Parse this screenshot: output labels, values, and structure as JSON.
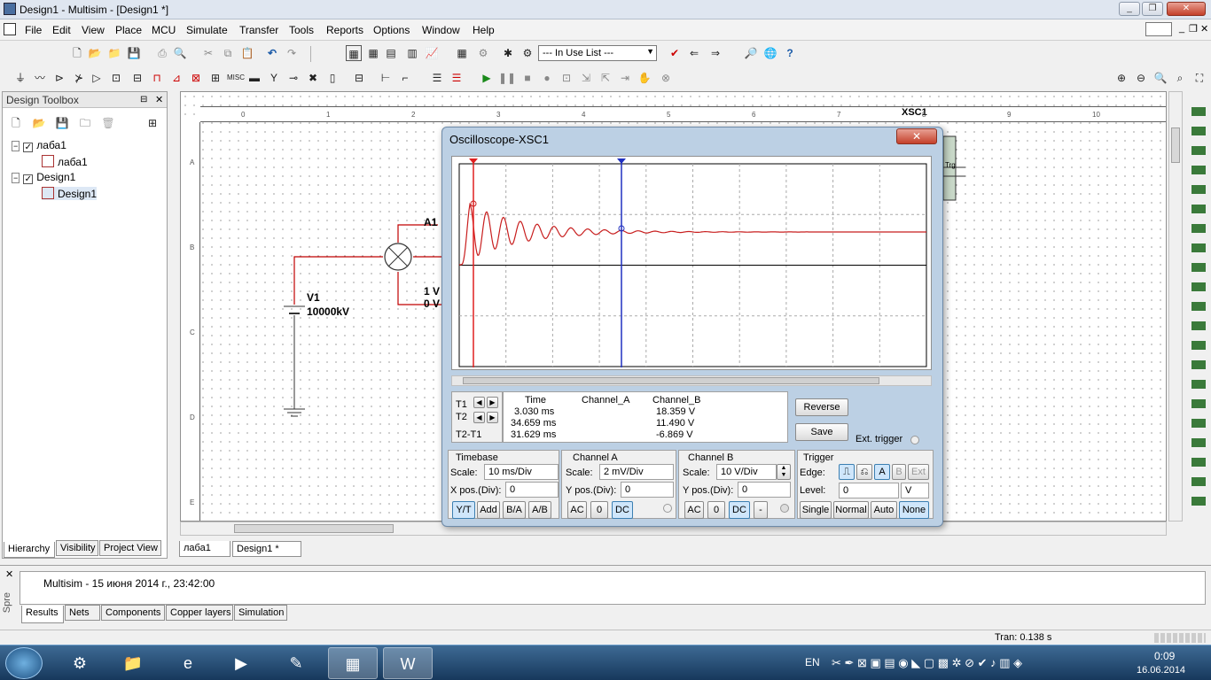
{
  "window": {
    "title": "Design1 - Multisim - [Design1 *]"
  },
  "menu": [
    "File",
    "Edit",
    "View",
    "Place",
    "MCU",
    "Simulate",
    "Transfer",
    "Tools",
    "Reports",
    "Options",
    "Window",
    "Help"
  ],
  "toolbar": {
    "inuse_list": "--- In Use List ---"
  },
  "toolbox": {
    "title": "Design Toolbox",
    "tree": [
      {
        "label": "лаба1",
        "level": 0
      },
      {
        "label": "лаба1",
        "level": 1
      },
      {
        "label": "Design1",
        "level": 0
      },
      {
        "label": "Design1",
        "level": 1
      }
    ],
    "tabs": [
      "Hierarchy",
      "Visibility",
      "Project View"
    ]
  },
  "canvas": {
    "ruler_ticks": [
      "0",
      "1",
      "2",
      "3",
      "4",
      "5",
      "6",
      "7",
      "8",
      "9",
      "10"
    ],
    "row_ticks": [
      "A",
      "B",
      "C",
      "D",
      "E"
    ],
    "component_label": "XSC1",
    "v1_name": "V1",
    "v1_value": "10000kV",
    "a1_name": "A1",
    "a1_v1": "1 V",
    "a1_v2": "0 V",
    "trg_label": "Trg"
  },
  "doc_tabs": [
    "лаба1",
    "Design1 *"
  ],
  "scope": {
    "title": "Oscilloscope-XSC1",
    "readout_headers": [
      "Time",
      "Channel_A",
      "Channel_B"
    ],
    "rows": [
      {
        "label": "T1",
        "time": "3.030 ms",
        "a": "",
        "b": "18.359 V"
      },
      {
        "label": "T2",
        "time": "34.659 ms",
        "a": "",
        "b": "11.490 V"
      },
      {
        "label": "T2-T1",
        "time": "31.629 ms",
        "a": "",
        "b": "-6.869 V"
      }
    ],
    "reverse_label": "Reverse",
    "save_label": "Save",
    "ext_trigger_label": "Ext. trigger",
    "timebase": {
      "title": "Timebase",
      "scale_label": "Scale:",
      "scale": "10 ms/Div",
      "xpos_label": "X pos.(Div):",
      "xpos": "0",
      "buttons": [
        "Y/T",
        "Add",
        "B/A",
        "A/B"
      ]
    },
    "channel_a": {
      "title": "Channel A",
      "scale_label": "Scale:",
      "scale": "2 mV/Div",
      "ypos_label": "Y pos.(Div):",
      "ypos": "0",
      "buttons": [
        "AC",
        "0",
        "DC"
      ]
    },
    "channel_b": {
      "title": "Channel B",
      "scale_label": "Scale:",
      "scale": "10  V/Div",
      "ypos_label": "Y pos.(Div):",
      "ypos": "0",
      "buttons": [
        "AC",
        "0",
        "DC",
        "-"
      ]
    },
    "trigger": {
      "title": "Trigger",
      "edge_label": "Edge:",
      "edge_buttons": [
        "A",
        "B",
        "Ext"
      ],
      "level_label": "Level:",
      "level": "0",
      "level_unit": "V",
      "buttons": [
        "Single",
        "Normal",
        "Auto",
        "None"
      ]
    }
  },
  "results": {
    "message": "Multisim  -  15 июня 2014 г., 23:42:00",
    "side_label": "Spre",
    "tabs": [
      "Results",
      "Nets",
      "Components",
      "Copper layers",
      "Simulation"
    ]
  },
  "status": {
    "tran": "Tran: 0.138 s"
  },
  "taskbar": {
    "lang": "EN",
    "time": "0:09",
    "date": "16.06.2014"
  },
  "colors": {
    "trace": "#c81e1e",
    "cursor1": "#e02020",
    "cursor2": "#2030c0",
    "wire": "#c00000"
  }
}
